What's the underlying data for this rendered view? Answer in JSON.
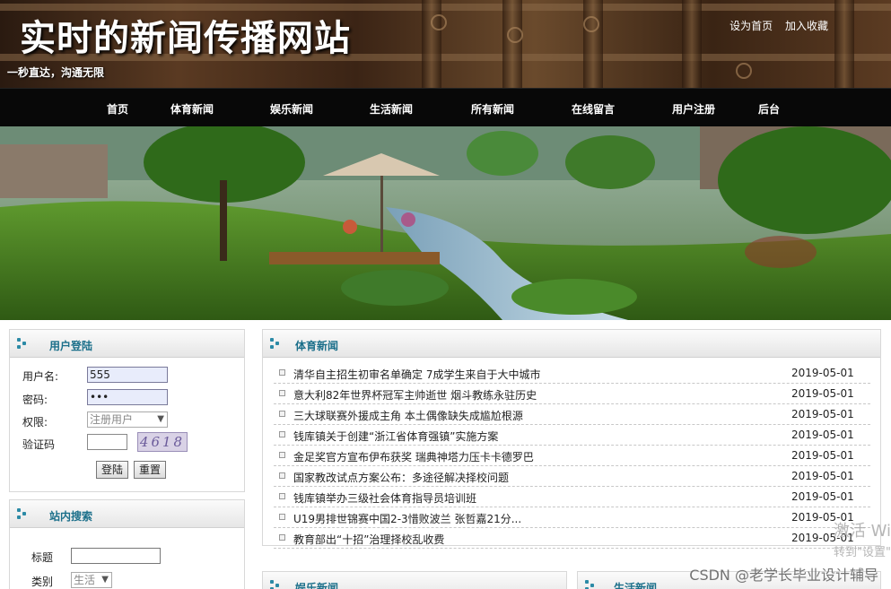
{
  "header": {
    "title": "实时的新闻传播网站",
    "slogan": "一秒直达，沟通无限",
    "links": [
      "设为首页",
      "加入收藏"
    ]
  },
  "nav": {
    "items": [
      "首页",
      "体育新闻",
      "娱乐新闻",
      "生活新闻",
      "所有新闻",
      "在线留言",
      "用户注册",
      "后台"
    ]
  },
  "login": {
    "title": "用户登陆",
    "username_label": "用户名:",
    "username_value": "555",
    "password_label": "密码:",
    "password_value": "•••",
    "role_label": "权限:",
    "role_value": "注册用户",
    "captcha_label": "验证码",
    "captcha_value": "",
    "captcha_image_text": "4618",
    "login_button": "登陆",
    "reset_button": "重置"
  },
  "search": {
    "title": "站内搜索",
    "title_label": "标题",
    "title_value": "",
    "category_label": "类别",
    "category_value": "生活"
  },
  "sports": {
    "title": "体育新闻",
    "items": [
      {
        "title": "清华自主招生初审名单确定 7成学生来自于大中城市",
        "date": "2019-05-01"
      },
      {
        "title": "意大利82年世界杯冠军主帅逝世 烟斗教练永驻历史",
        "date": "2019-05-01"
      },
      {
        "title": "三大球联赛外援成主角 本土偶像缺失成尴尬根源",
        "date": "2019-05-01"
      },
      {
        "title": "钱库镇关于创建“浙江省体育强镇”实施方案",
        "date": "2019-05-01"
      },
      {
        "title": "金足奖官方宣布伊布获奖 瑞典神塔力压卡卡德罗巴",
        "date": "2019-05-01"
      },
      {
        "title": "国家教改试点方案公布：多途径解决择校问题",
        "date": "2019-05-01"
      },
      {
        "title": "钱库镇举办三级社会体育指导员培训班",
        "date": "2019-05-01"
      },
      {
        "title": "U19男排世锦赛中国2-3惜败波兰 张哲嘉21分...",
        "date": "2019-05-01"
      },
      {
        "title": "教育部出“十招”治理择校乱收费",
        "date": "2019-05-01"
      }
    ]
  },
  "entertainment": {
    "title": "娱乐新闻"
  },
  "life": {
    "title": "生活新闻"
  },
  "overlay": {
    "activate_line1": "激活 Wi",
    "activate_line2": "转到\"设置\"",
    "watermark": "CSDN @老学长毕业设计辅导"
  },
  "colors": {
    "accent": "#1b6f8a",
    "nav_bg": "#080808"
  }
}
